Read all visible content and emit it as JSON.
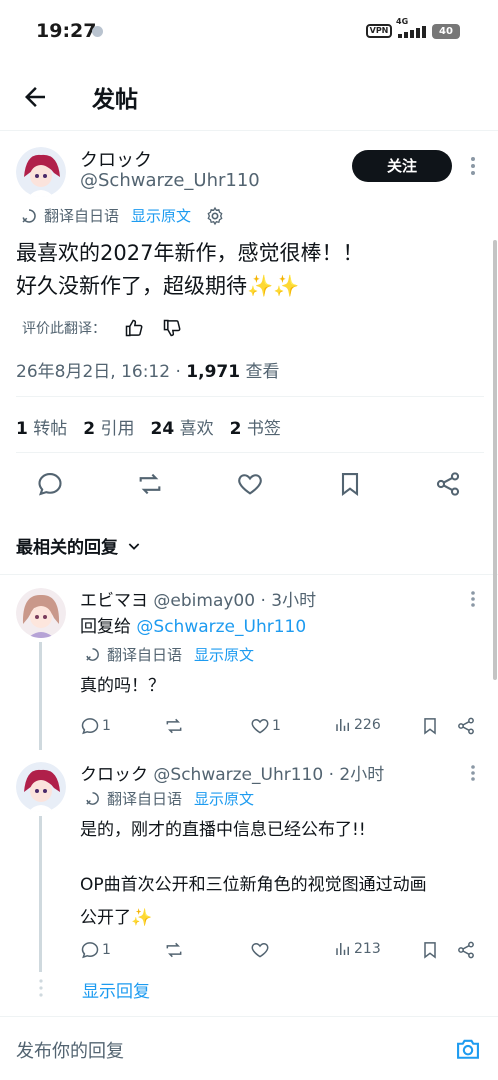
{
  "status_bar": {
    "time": "19:27",
    "vpn": "VPN",
    "network": "4G",
    "battery": "40"
  },
  "header": {
    "title": "发帖"
  },
  "post": {
    "name": "クロック",
    "handle": "@Schwarze_Uhr110",
    "follow_label": "关注",
    "translated_from": "翻译自日语",
    "show_original": "显示原文",
    "text_line1": "最喜欢的2027年新作，感觉很棒！！",
    "text_line2": "好久没新作了，超级期待✨✨",
    "rate_label": "评价此翻译：",
    "date": "26年8月2日, 16:12 · ",
    "views_count": "1,971",
    "views_label": " 查看",
    "stats": {
      "reposts_n": "1",
      "reposts_l": "转帖",
      "quotes_n": "2",
      "quotes_l": "引用",
      "likes_n": "24",
      "likes_l": "喜欢",
      "bookmarks_n": "2",
      "bookmarks_l": "书签"
    }
  },
  "sort_label": "最相关的回复",
  "replies": [
    {
      "name": "エビマヨ",
      "handle": "@ebimay00 · 3小时",
      "reply_to_prefix": "回复给 ",
      "reply_to": "@Schwarze_Uhr110",
      "translated_from": "翻译自日语",
      "show_original": "显示原文",
      "text": "真的吗！？",
      "replies": "1",
      "reposts": "",
      "likes": "1",
      "views": "226"
    },
    {
      "name": "クロック",
      "handle": "@Schwarze_Uhr110 · 2小时",
      "translated_from": "翻译自日语",
      "show_original": "显示原文",
      "text1": "是的，刚才的直播中信息已经公布了!!",
      "text2": "OP曲首次公开和三位新角色的视觉图通过动画",
      "text3": "公开了✨",
      "replies": "1",
      "reposts": "",
      "likes": "",
      "views": "213"
    }
  ],
  "show_replies": "显示回复",
  "composer": {
    "placeholder": "发布你的回复"
  },
  "colors": {
    "accent": "#1d9bf0",
    "text": "#0f1419",
    "secondary": "#536471"
  }
}
